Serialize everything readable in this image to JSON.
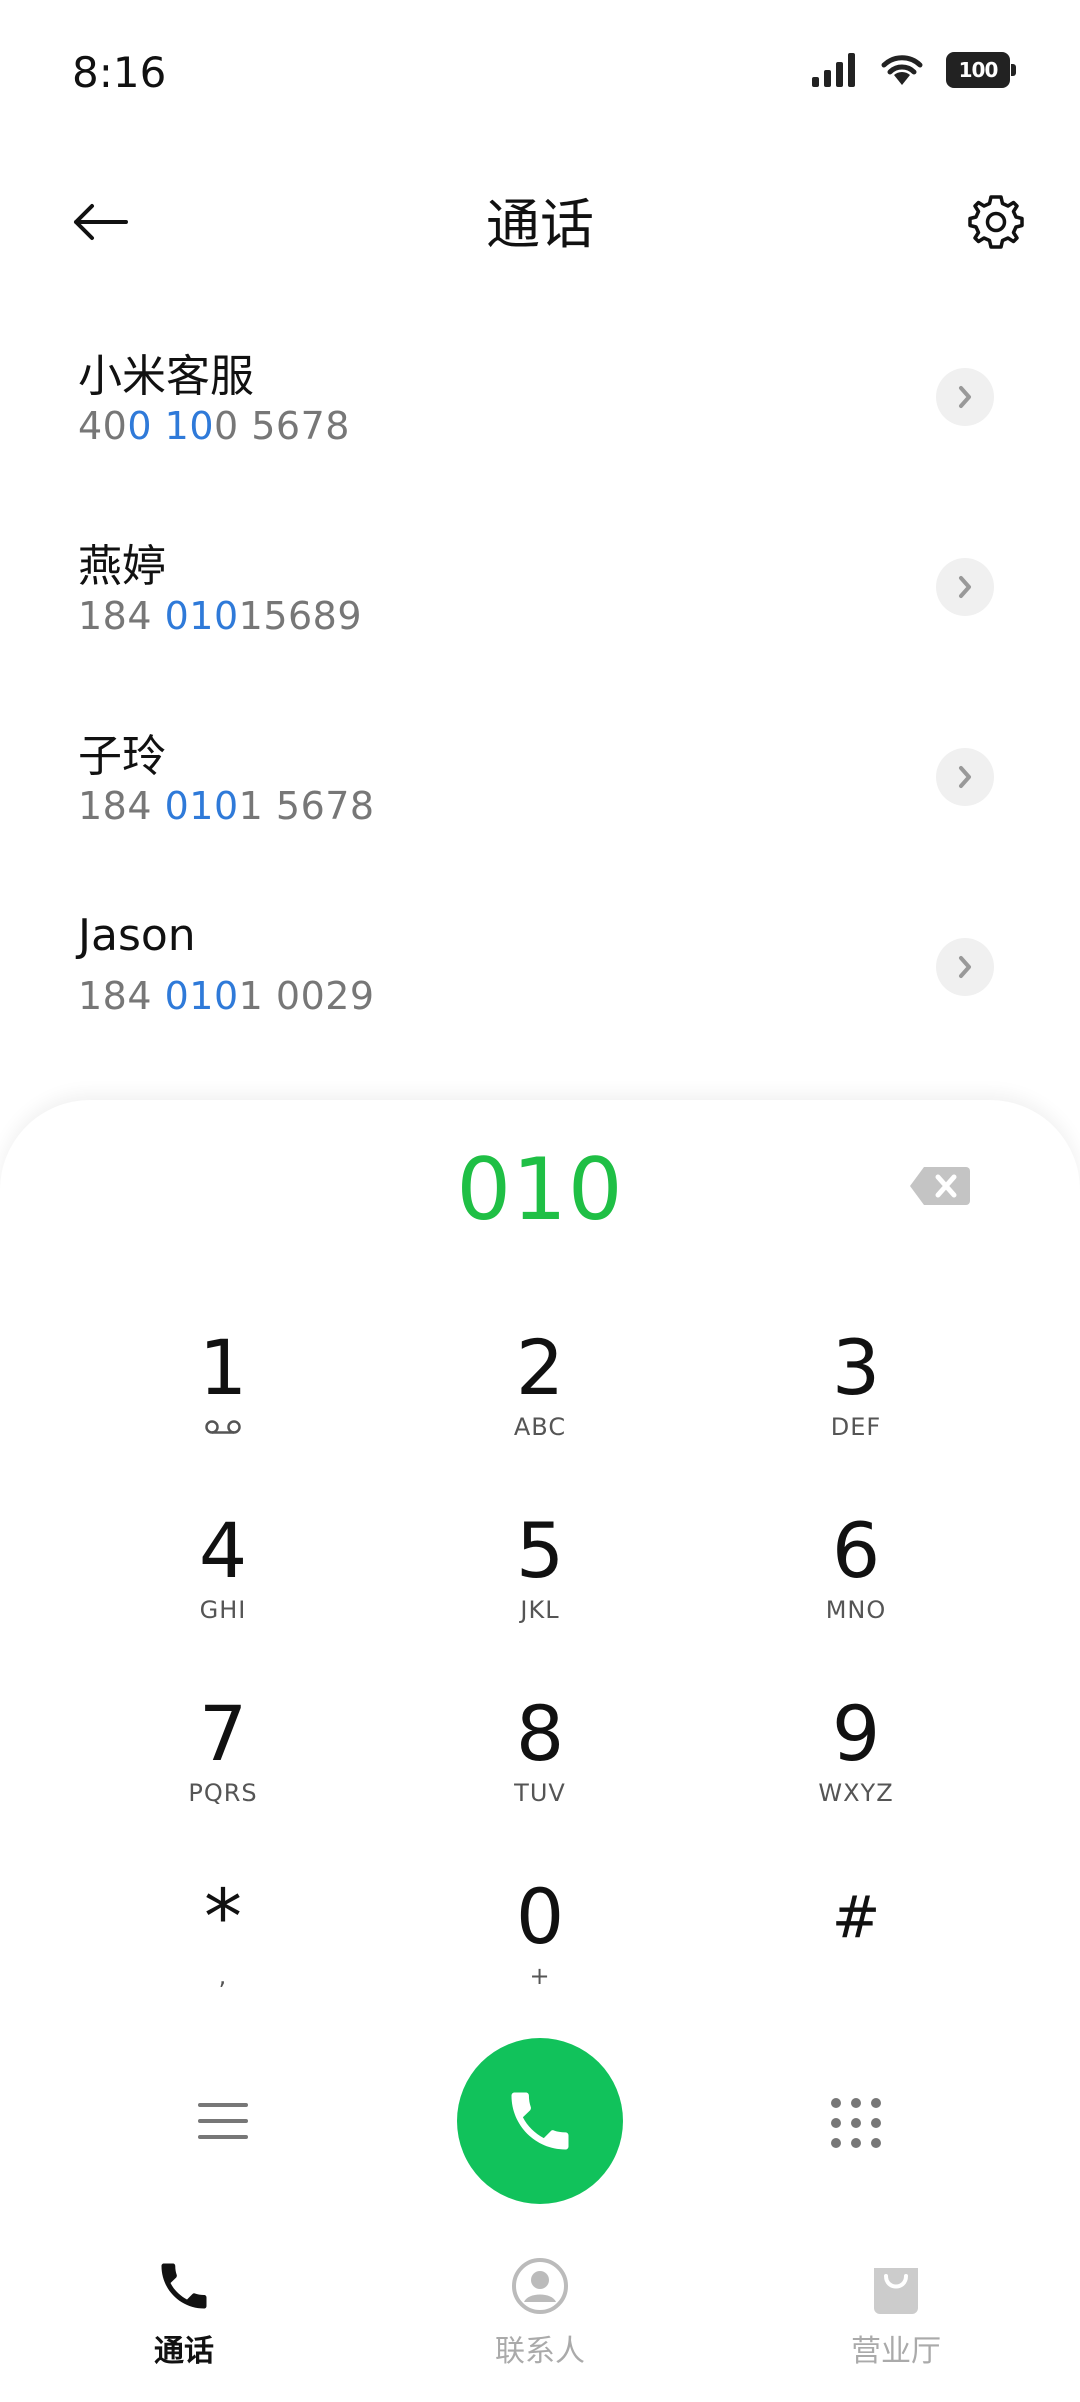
{
  "status_bar": {
    "time": "8:16",
    "battery": "100",
    "icons": [
      "signal-icon",
      "wifi-icon",
      "battery-icon"
    ]
  },
  "header": {
    "title": "通话",
    "back_icon": "back-arrow-icon",
    "settings_icon": "gear-icon"
  },
  "results": [
    {
      "name": "小米客服",
      "number_parts": [
        {
          "text": "40",
          "hl": false
        },
        {
          "text": "0",
          "hl": true
        },
        {
          "text": " ",
          "hl": false
        },
        {
          "text": "10",
          "hl": true
        },
        {
          "text": "0 5678",
          "hl": false
        }
      ]
    },
    {
      "name": "燕婷",
      "number_parts": [
        {
          "text": "184 ",
          "hl": false
        },
        {
          "text": "010",
          "hl": true
        },
        {
          "text": "15689",
          "hl": false
        }
      ]
    },
    {
      "name": "子玲",
      "number_parts": [
        {
          "text": "184 ",
          "hl": false
        },
        {
          "text": "010",
          "hl": true
        },
        {
          "text": "1 5678",
          "hl": false
        }
      ]
    },
    {
      "name": "Jason",
      "number_parts": [
        {
          "text": "184 ",
          "hl": false
        },
        {
          "text": "010",
          "hl": true
        },
        {
          "text": "1 0029",
          "hl": false
        }
      ]
    }
  ],
  "dialpad": {
    "dialed": "010",
    "keys": [
      {
        "digit": "1",
        "letters": "",
        "sub_icon": "voicemail-icon"
      },
      {
        "digit": "2",
        "letters": "ABC"
      },
      {
        "digit": "3",
        "letters": "DEF"
      },
      {
        "digit": "4",
        "letters": "GHI"
      },
      {
        "digit": "5",
        "letters": "JKL"
      },
      {
        "digit": "6",
        "letters": "MNO"
      },
      {
        "digit": "7",
        "letters": "PQRS"
      },
      {
        "digit": "8",
        "letters": "TUV"
      },
      {
        "digit": "9",
        "letters": "WXYZ"
      },
      {
        "digit": "*",
        "letters": ","
      },
      {
        "digit": "0",
        "letters": "+"
      },
      {
        "digit": "#",
        "letters": ""
      }
    ]
  },
  "bottom_nav": {
    "items": [
      {
        "label": "通话",
        "icon": "phone-icon",
        "active": true
      },
      {
        "label": "联系人",
        "icon": "contact-icon",
        "active": false
      },
      {
        "label": "营业厅",
        "icon": "shop-bag-icon",
        "active": false
      }
    ]
  },
  "colors": {
    "accent_green": "#1fbf45",
    "call_button": "#11c25b",
    "highlight_blue": "#2f7ad9"
  }
}
